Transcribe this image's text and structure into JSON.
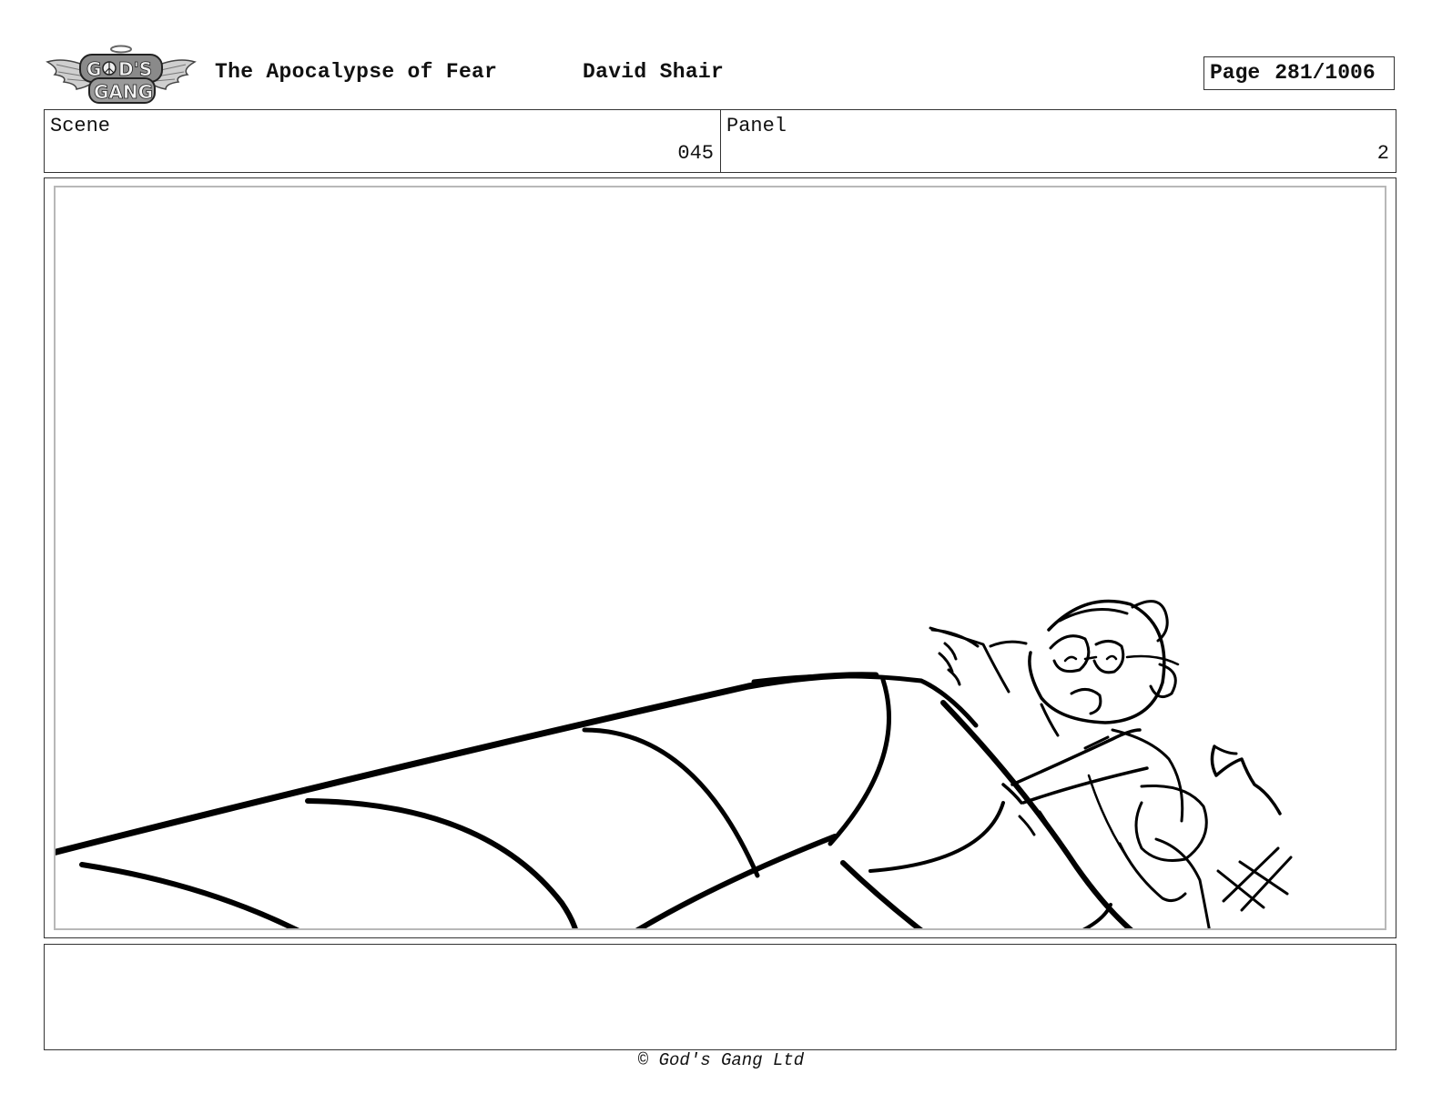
{
  "header": {
    "logo_text": "GOD'S GANG",
    "title": "The Apocalypse of Fear",
    "author": "David Shair",
    "page_label": "Page",
    "page_number": "281/1006"
  },
  "info": {
    "scene_label": "Scene",
    "scene_value": "045",
    "panel_label": "Panel",
    "panel_value": "2"
  },
  "footer": {
    "copyright": "© God's Gang Ltd"
  }
}
